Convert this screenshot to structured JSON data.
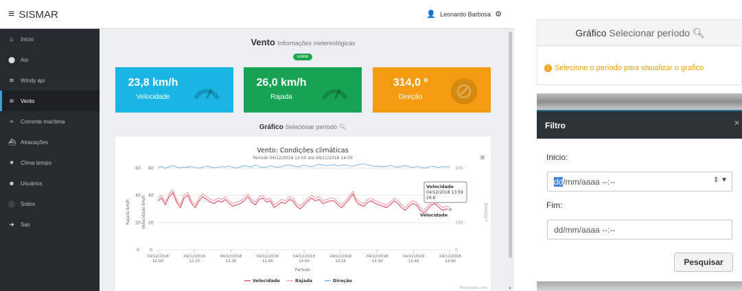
{
  "app": {
    "brand": "SISMAR",
    "user_name": "Leonardo Barbosa"
  },
  "sidebar": {
    "items": [
      {
        "label": "Início",
        "icon": "home-icon"
      },
      {
        "label": "Ais",
        "icon": "map-marker-icon"
      },
      {
        "label": "Windy api",
        "icon": "wind-icon"
      },
      {
        "label": "Vento",
        "icon": "wind-icon",
        "active": true
      },
      {
        "label": "Corrente marítima",
        "icon": "waves-icon"
      },
      {
        "label": "Atracações",
        "icon": "ship-icon"
      },
      {
        "label": "Clima tempo",
        "icon": "sun-icon"
      },
      {
        "label": "Usuários",
        "icon": "users-icon"
      },
      {
        "label": "Sobre",
        "icon": "info-icon"
      },
      {
        "label": "Sair",
        "icon": "logout-icon"
      }
    ]
  },
  "vento": {
    "title": "Vento",
    "subtitle": "Informações metereológicas",
    "status": "online",
    "cards": [
      {
        "value": "23,8 km/h",
        "label": "Velocidade",
        "color": "#19b5e3"
      },
      {
        "value": "26,0 km/h",
        "label": "Rajada",
        "color": "#16a454"
      },
      {
        "value": "314,0 º",
        "label": "Direção",
        "color": "#f39c12"
      }
    ]
  },
  "grafico": {
    "title": "Gráfico",
    "link": "Selecionar período"
  },
  "chart_data": {
    "type": "line",
    "title": "Vento: Condições climáticas",
    "subtitle": "Período 04/12/2018 12:00 até 04/12/2018 14:00",
    "xlabel": "Período",
    "ylabel_left_outer": "Rajada km/h",
    "ylabel_left_inner": "Velocidade km/h",
    "ylabel_right": "Direção º",
    "x_ticks": [
      "04/12/2018 12:00",
      "04/12/2018 12:15",
      "04/12/2018 12:30",
      "04/12/2018 12:45",
      "04/12/2018 13:00",
      "04/12/2018 13:15",
      "04/12/2018 13:30",
      "04/12/2018 13:45",
      "04/12/2018 14:00"
    ],
    "y_ticks_outer": [
      "60",
      "40",
      "20",
      "0"
    ],
    "y_ticks_inner": [
      "60",
      "40",
      "20",
      "0"
    ],
    "y_ticks_right": [
      "300",
      "200",
      "100",
      "0"
    ],
    "ylim_left": [
      0,
      60
    ],
    "ylim_right": [
      0,
      300
    ],
    "series": [
      {
        "name": "Velocidade",
        "color": "#e05a6a",
        "axis": "left",
        "values": [
          36,
          38,
          33,
          39,
          42,
          35,
          31,
          38,
          40,
          34,
          31,
          36,
          39,
          37,
          35,
          34,
          36,
          35,
          37,
          34,
          32,
          33,
          34,
          36,
          39,
          35,
          33,
          37,
          38,
          35,
          36,
          31,
          33,
          35,
          34,
          37,
          36,
          32,
          30,
          33,
          36,
          38,
          36,
          37,
          34,
          35,
          36,
          36,
          33,
          31,
          34,
          37,
          41,
          35,
          33,
          32,
          35,
          36,
          34,
          33,
          32,
          31,
          33,
          36,
          34,
          31,
          29,
          32,
          34,
          33,
          29,
          27,
          30,
          33,
          34,
          31,
          29,
          30,
          29.6
        ]
      },
      {
        "name": "Rajada",
        "color": "#f2a6ae",
        "axis": "left",
        "values": [
          38,
          40,
          35,
          41,
          44,
          37,
          33,
          40,
          42,
          36,
          33,
          38,
          41,
          39,
          37,
          36,
          38,
          37,
          39,
          36,
          34,
          35,
          36,
          38,
          41,
          37,
          35,
          39,
          40,
          37,
          38,
          33,
          35,
          37,
          36,
          39,
          38,
          34,
          32,
          35,
          38,
          40,
          38,
          39,
          36,
          37,
          38,
          38,
          35,
          33,
          36,
          39,
          43,
          37,
          35,
          34,
          37,
          38,
          36,
          35,
          34,
          33,
          35,
          38,
          36,
          33,
          31,
          34,
          36,
          35,
          31,
          29,
          32,
          35,
          36,
          33,
          31,
          32,
          31
        ]
      },
      {
        "name": "Direção",
        "color": "#7fb6e6",
        "axis": "right",
        "values": [
          302,
          306,
          300,
          305,
          309,
          304,
          301,
          304,
          303,
          306,
          302,
          300,
          303,
          307,
          305,
          301,
          303,
          306,
          304,
          308,
          303,
          300,
          305,
          309,
          307,
          304,
          312,
          306,
          302,
          304,
          309,
          305,
          303,
          306,
          310,
          312,
          309,
          305,
          307,
          311,
          308,
          305,
          310,
          314,
          312,
          309,
          311,
          313,
          308,
          310,
          312,
          309,
          307,
          311,
          314,
          316,
          312,
          309,
          306,
          308,
          305,
          307,
          309,
          306,
          303,
          307,
          310,
          305,
          302,
          306,
          304,
          300,
          303,
          307,
          305,
          302,
          306,
          304,
          305
        ]
      }
    ],
    "tooltip": {
      "series": "Velocidade",
      "time": "04/12/2018 13:59",
      "value": "29.6"
    },
    "end_label": "Velocidade",
    "legend": [
      "Velocidade",
      "Rajada",
      "Direção"
    ],
    "legend_position": "bottom",
    "credits": "Highcharts.com"
  },
  "right_panel": {
    "title": "Gráfico",
    "link": "Selecionar período",
    "message": "Selecione o período para visualizar o grafico"
  },
  "modal": {
    "title": "Filtro",
    "close": "×",
    "inicio_label": "Inicio:",
    "inicio_value_highlight": "dd",
    "inicio_value_rest": "/mm/aaaa --:--",
    "fim_label": "Fim:",
    "fim_value": "dd/mm/aaaa --:--",
    "button": "Pesquisar"
  }
}
